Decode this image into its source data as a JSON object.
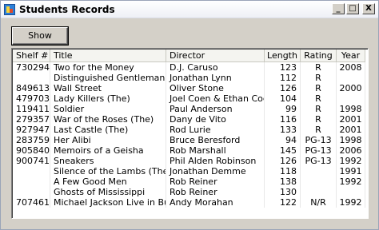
{
  "window": {
    "title": "Students Records",
    "minimize_label": "_",
    "maximize_label": "□",
    "close_label": "X"
  },
  "toolbar": {
    "show_label": "Show"
  },
  "table": {
    "columns": [
      "Shelf #",
      "Title",
      "Director",
      "Length",
      "Rating",
      "Year"
    ],
    "rows": [
      [
        "730294",
        "Two for the Money",
        "D.J. Caruso",
        "123",
        "R",
        "2008"
      ],
      [
        "",
        "Distinguished Gentleman (The)",
        "Jonathan Lynn",
        "112",
        "R",
        ""
      ],
      [
        "849613",
        "Wall Street",
        "Oliver Stone",
        "126",
        "R",
        "2000"
      ],
      [
        "479703",
        "Lady Killers (The)",
        "Joel Coen & Ethan Coen",
        "104",
        "R",
        ""
      ],
      [
        "119411",
        "Soldier",
        "Paul Anderson",
        "99",
        "R",
        "1998"
      ],
      [
        "279357",
        "War of the Roses (The)",
        "Dany de Vito",
        "116",
        "R",
        "2001"
      ],
      [
        "927947",
        "Last Castle (The)",
        "Rod Lurie",
        "133",
        "R",
        "2001"
      ],
      [
        "283759",
        "Her Alibi",
        "Bruce Beresford",
        "94",
        "PG-13",
        "1998"
      ],
      [
        "905840",
        "Memoirs of a Geisha",
        "Rob Marshall",
        "145",
        "PG-13",
        "2006"
      ],
      [
        "900741",
        "Sneakers",
        "Phil Alden Robinson",
        "126",
        "PG-13",
        "1992"
      ],
      [
        "",
        "Silence of the Lambs (The)",
        "Jonathan Demme",
        "118",
        "",
        "1991"
      ],
      [
        "",
        "A Few Good Men",
        "Rob Reiner",
        "138",
        "",
        "1992"
      ],
      [
        "",
        "Ghosts of Mississippi",
        "Rob Reiner",
        "130",
        "",
        ""
      ],
      [
        "707461",
        "Michael Jackson Live in Buc...",
        "Andy Morahan",
        "122",
        "N/R",
        "1992"
      ]
    ]
  }
}
